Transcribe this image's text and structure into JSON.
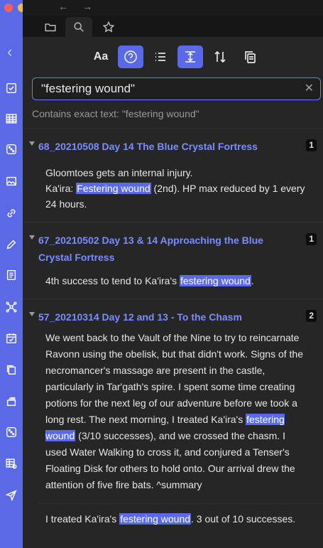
{
  "window": {
    "colors": {
      "close": "#ff5f57",
      "minimize": "#febc2e",
      "maximize": "#28c840",
      "accent": "#5a6ae6",
      "link": "#7b8cff"
    }
  },
  "ribbon": {
    "icons": [
      "collapse-icon",
      "checkbox-icon",
      "table-icon",
      "dice-icon",
      "image-icon",
      "link-icon",
      "pencil-icon",
      "document-icon",
      "graph-icon",
      "calendar-icon",
      "copy-icon",
      "layers-icon",
      "dice-icon",
      "table-gear-icon",
      "send-icon"
    ]
  },
  "tabs": [
    "folder-icon",
    "search-icon",
    "star-icon"
  ],
  "toolbar": {
    "case_label": "Aa",
    "buttons": [
      "match-case-button",
      "explain-button",
      "collapse-results-button",
      "show-more-context-button",
      "sort-button",
      "copy-results-button"
    ]
  },
  "search": {
    "value": "\"festering wound\"",
    "hint": "Contains exact text: \"festering wound\""
  },
  "results": [
    {
      "title": "68_20210508 Day 14 The Blue Crystal Fortress",
      "count": "1",
      "matches": [
        {
          "pre": "Gloomtoes gets an internal injury.",
          "line2_pre": "Ka'ira: ",
          "hl": "Festering wound",
          "post": " (2nd). HP max reduced by 1 every 24 hours."
        }
      ]
    },
    {
      "title": "67_20210502 Day 13 & 14 Approaching the Blue Crystal Fortress",
      "count": "1",
      "matches": [
        {
          "pre": "4th success to tend to Ka'ira's ",
          "hl": "festering wound",
          "post": "."
        }
      ]
    },
    {
      "title": "57_20210314 Day 12 and 13 - To the Chasm",
      "count": "2",
      "matches": [
        {
          "pre": "We went back to the Vault of the Nine to try to reincarnate Ravonn using the obelisk, but that didn't work. Signs of the necromancer's massage are present in the castle, particularly in Tar'gath's spire. I spent some time creating potions for the next leg of our adventure before we took a long rest. The next morning, I treated Ka'ira's ",
          "hl": "festering wound",
          "post": " (3/10 successes), and we crossed the chasm. I used Water Walking to cross it, and conjured a Tenser's Floating Disk for others to hold onto. Our arrival drew the attention of five fire bats. ^summary"
        },
        {
          "pre": "I treated Ka'ira's ",
          "hl": "festering wound",
          "post": ". 3 out of 10 successes."
        }
      ]
    }
  ]
}
